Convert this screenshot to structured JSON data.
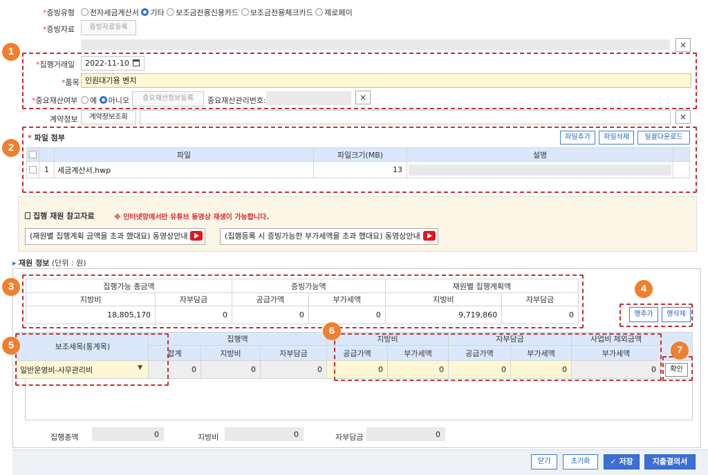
{
  "evidence_type": {
    "label": "증빙유형",
    "options": [
      "전자세금계산서",
      "기타",
      "보조금전용신용카드",
      "보조금전용체크카드",
      "제로페이"
    ],
    "selected": "기타"
  },
  "evidence_docs": {
    "label": "증빙자료",
    "button": "증빙자료등록"
  },
  "exec_date": {
    "label": "집행거래일",
    "value": "2022-11-10"
  },
  "item": {
    "label": "품목",
    "value": "인원대기용 벤치"
  },
  "major_asset": {
    "label": "중요재산여부",
    "yes": "예",
    "no": "아니오",
    "selected": "아니오",
    "reg_button": "중요재산정보등록",
    "mgmt_label": "중요재산관리번호:"
  },
  "contract": {
    "label": "계약정보",
    "button": "계약정보조회"
  },
  "attachments": {
    "title": "파일 첨부",
    "buttons": {
      "add": "파일추가",
      "delete": "파일삭제",
      "download": "일괄다운로드"
    },
    "columns": [
      "파일",
      "파일크기(MB)",
      "설명"
    ],
    "rows": [
      {
        "no": "1",
        "name": "세금계산서.hwp",
        "size": "13",
        "desc": ""
      }
    ]
  },
  "reference": {
    "title": "집행 재원 참고자료",
    "notice": "※ 인터넷망에서만 유튜브 동영상 재생이 가능합니다.",
    "video1": "(재원별 집행계획 금액을 초과 했대요) 동영상안내",
    "video2": "(집행등록 시 증빙가능한 부가세액을 초과 했대요) 동영상안내"
  },
  "fund_info": {
    "title": "재원 정보",
    "unit": "(단위 : 원)"
  },
  "summary": {
    "groups": [
      "집행가능 총금액",
      "증빙가능액",
      "재원별 집행계획액"
    ],
    "cols": [
      "지방비",
      "자부담금",
      "공급가액",
      "부가세액",
      "지방비",
      "자부담금"
    ],
    "values": [
      "18,805,170",
      "0",
      "0",
      "0",
      "9,719,860",
      "0"
    ]
  },
  "row_buttons": {
    "add": "행추가",
    "delete": "행삭제"
  },
  "detail": {
    "sub_item_header": "보조세목(통계목)",
    "group_exec": "집행액",
    "group_local": "지방비",
    "group_self": "자부담금",
    "group_excl": "사업비 제외금액",
    "cols": [
      "합계",
      "지방비",
      "자부담금",
      "공급가액",
      "부가세액",
      "공급가액",
      "부가세액",
      "부가세액"
    ],
    "sub_item_value": "일반운영비-사무관리비",
    "values": [
      "0",
      "0",
      "0",
      "0",
      "0",
      "0",
      "0",
      "0"
    ],
    "confirm": "확인"
  },
  "totals": [
    {
      "label": "집행총액",
      "value": "0"
    },
    {
      "label": "지방비",
      "value": "0"
    },
    {
      "label": "자부담금",
      "value": "0"
    }
  ],
  "footer": {
    "close": "닫기",
    "reset": "초기화",
    "save": "저장",
    "resolution": "지출결의서"
  },
  "markers": [
    "1",
    "2",
    "3",
    "4",
    "5",
    "6",
    "7"
  ]
}
